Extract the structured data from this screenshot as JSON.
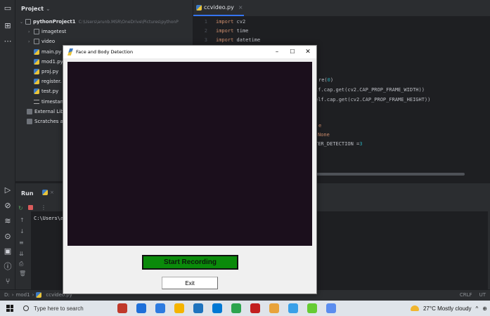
{
  "ide": {
    "project_panel": {
      "title": "Project",
      "tree": [
        {
          "label": "pythonProject1",
          "path": "C:\\Users\\arunb.MSR\\OneDrive\\Pictures\\pythonP",
          "type": "folder",
          "expanded": true
        },
        {
          "label": "imagetest",
          "type": "folder"
        },
        {
          "label": "video",
          "type": "folder"
        },
        {
          "label": "main.py",
          "type": "py"
        },
        {
          "label": "mod1.py",
          "type": "py"
        },
        {
          "label": "proj.py",
          "type": "py"
        },
        {
          "label": "register.",
          "type": "py"
        },
        {
          "label": "test.py",
          "type": "py"
        },
        {
          "label": "timestan",
          "type": "txt"
        },
        {
          "label": "External Lib",
          "type": "lib"
        },
        {
          "label": "Scratches a",
          "type": "lib"
        }
      ]
    },
    "editor": {
      "tab_label": "ccvideo.py",
      "lines": [
        {
          "n": "1",
          "kw": "import",
          "rest": " cv2"
        },
        {
          "n": "2",
          "kw": "import",
          "rest": " time"
        },
        {
          "n": "3",
          "kw": "import",
          "rest": " datetime"
        }
      ],
      "visible_fragments": [
        {
          "text": "re(0)"
        },
        {
          "text": "lf.cap.get(cv2.CAP_PROP_FRAME_WIDTH))"
        },
        {
          "text": "elf.cap.get(cv2.CAP_PROP_FRAME_HEIGHT))"
        },
        {
          "text": "e"
        },
        {
          "text": "None"
        },
        {
          "text": "TER_DETECTION = 3"
        }
      ]
    },
    "run_panel": {
      "title": "Run",
      "console_line": "C:\\Users\\a"
    },
    "status_bar": {
      "crumbs": [
        "D:",
        "mod1",
        "ccvideo.py"
      ],
      "right": [
        "CRLF",
        "UT"
      ]
    }
  },
  "tk_window": {
    "title": "Face and Body Detection",
    "start_button": "Start Recording",
    "exit_button": "Exit",
    "canvas_color": "#1b0f1c",
    "start_color": "#0a8a0a"
  },
  "taskbar": {
    "search_placeholder": "Type here to search",
    "weather": "27°C  Mostly cloudy",
    "apps": [
      "#c0392b",
      "#1e6fd9",
      "#2d7be0",
      "#f5b400",
      "#1e73be",
      "#0078d4",
      "#2da44e",
      "#c21f1f",
      "#e8a33b",
      "#3aa0e8",
      "#6c3",
      "#5b8def"
    ]
  }
}
